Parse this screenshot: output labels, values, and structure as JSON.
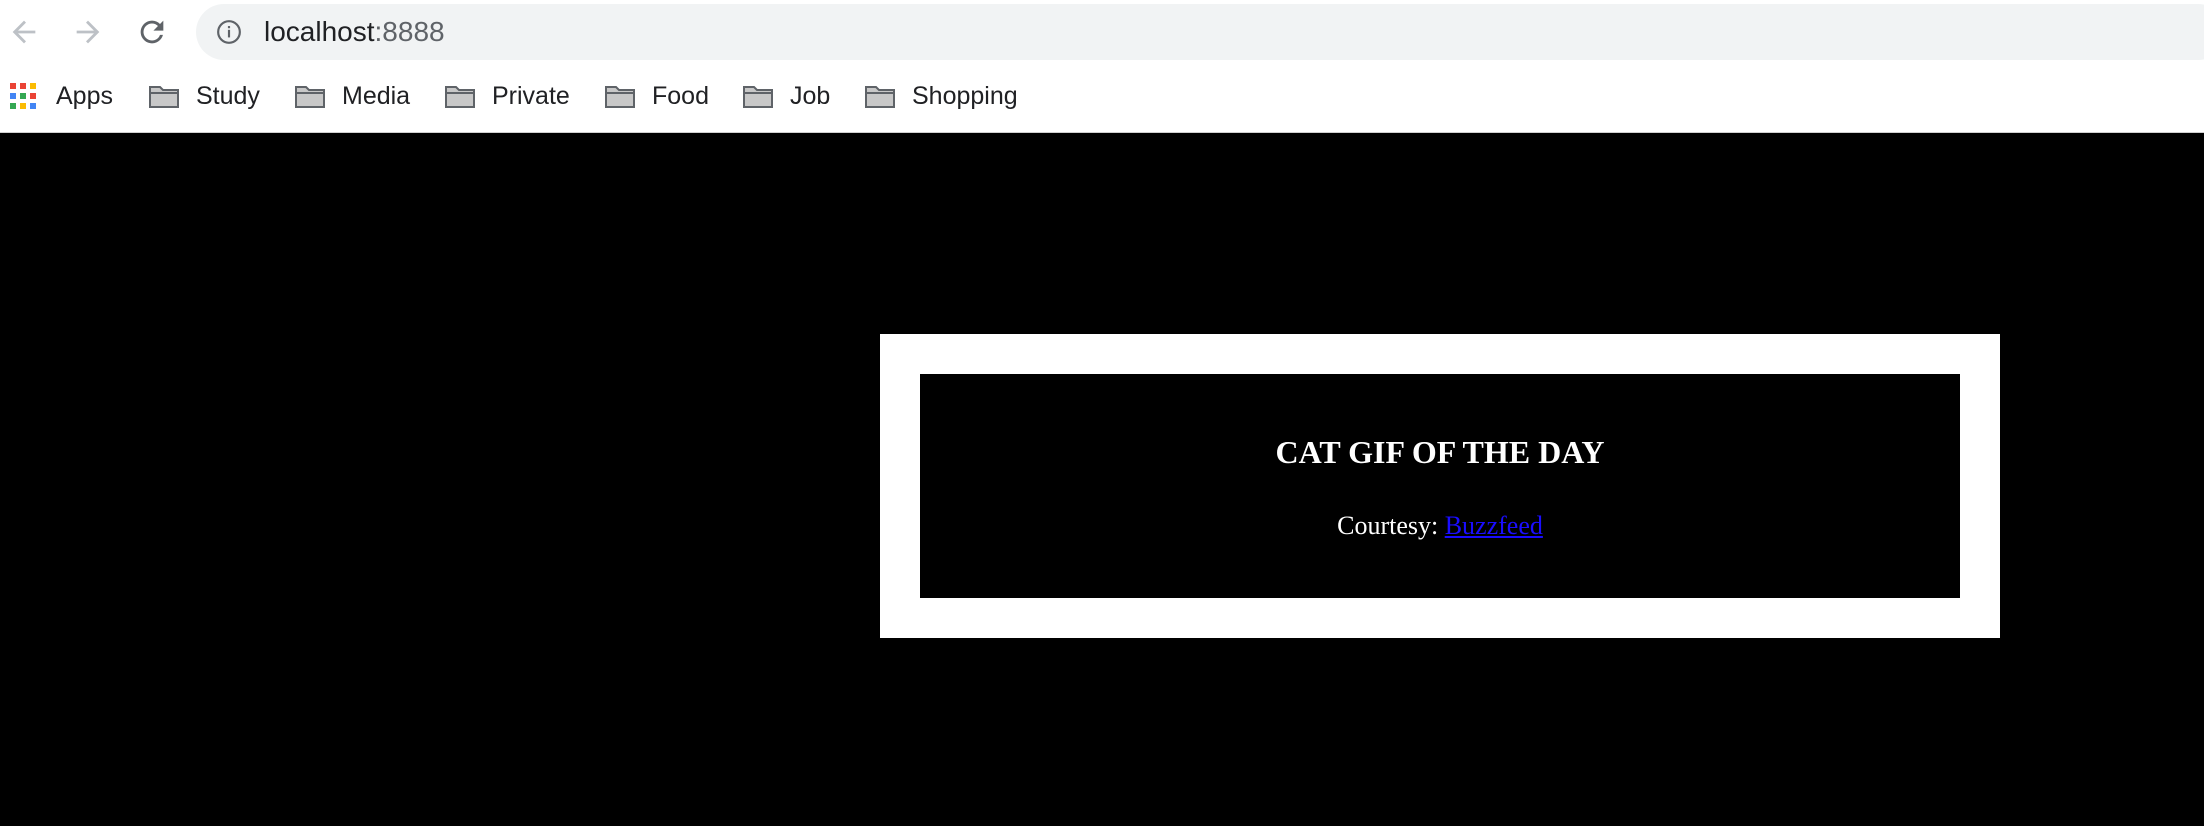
{
  "toolbar": {
    "back_icon": "arrow-left-icon",
    "forward_icon": "arrow-right-icon",
    "reload_icon": "reload-icon",
    "address": {
      "info_icon": "info-icon",
      "host": "localhost",
      "port": ":8888"
    }
  },
  "bookmarks": {
    "apps_label": "Apps",
    "items": [
      {
        "label": "Study",
        "icon": "folder-icon"
      },
      {
        "label": "Media",
        "icon": "folder-icon"
      },
      {
        "label": "Private",
        "icon": "folder-icon"
      },
      {
        "label": "Food",
        "icon": "folder-icon"
      },
      {
        "label": "Job",
        "icon": "folder-icon"
      },
      {
        "label": "Shopping",
        "icon": "folder-icon"
      }
    ]
  },
  "page": {
    "title": "CAT GIF OF THE DAY",
    "credit_prefix": "Courtesy: ",
    "credit_link": "Buzzfeed"
  },
  "colors": {
    "page_background": "#000000",
    "card_border": "#ffffff",
    "link": "#1a0dff"
  }
}
